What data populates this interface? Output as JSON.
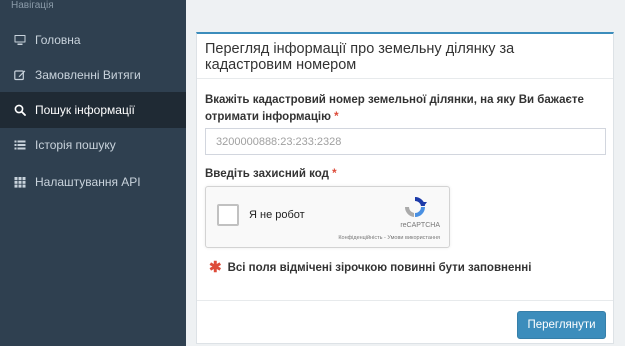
{
  "sidebar": {
    "heading": "Навігація",
    "items": [
      {
        "label": "Головна",
        "icon": "monitor-icon"
      },
      {
        "label": "Замовленні Витяги",
        "icon": "edit-icon"
      },
      {
        "label": "Пошук інформації",
        "icon": "search-icon",
        "active": true
      },
      {
        "label": "Історія пошуку",
        "icon": "list-icon"
      },
      {
        "label": "Налаштування API",
        "icon": "grid-icon"
      }
    ]
  },
  "panel": {
    "title": "Перегляд інформації про земельну ділянку за кадастровим номером",
    "cadastral_label": "Вкажіть кадастровий номер земельної ділянки, на яку Ви бажаєте отримати інформацію",
    "cadastral_placeholder": "3200000888:23:233:2328",
    "captcha_label": "Введіть захисний код",
    "required_mark": "*",
    "notice": "Всі поля відмічені зірочкою повинні бути заповненні",
    "notice_star": "✱",
    "submit_label": "Переглянути"
  },
  "captcha": {
    "checkbox_label": "Я не робот",
    "brand": "reCAPTCHA",
    "links": "Конфіденційність - Умови використання"
  },
  "colors": {
    "sidebar_bg": "#2f4050",
    "sidebar_active_bg": "#1f2a34",
    "accent": "#3c8dbc",
    "required": "#dd4b39"
  }
}
